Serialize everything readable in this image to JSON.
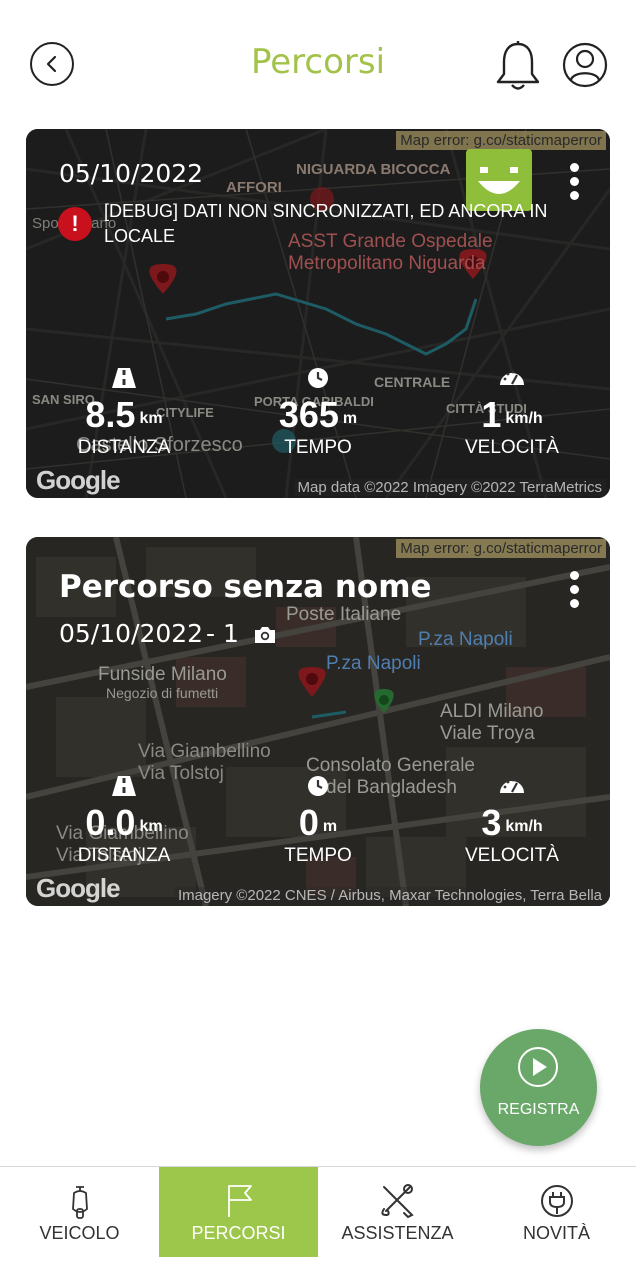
{
  "header": {
    "title": "Percorsi",
    "back_icon": "back-arrow-icon",
    "notification_icon": "bell-icon",
    "profile_icon": "user-icon"
  },
  "colors": {
    "accent": "#a3c24a",
    "active_tab": "#9dc74a",
    "fab": "#6aa86a",
    "error": "#c8111d"
  },
  "routes": [
    {
      "map_error": "Map error: g.co/staticmaperror",
      "date": "05/10/2022",
      "debug_message": "[DEBUG] DATI NON SINCRONIZZATI, ED ANCORA IN LOCALE",
      "stats": {
        "distance": {
          "value": "8.5",
          "unit": "km",
          "label": "DISTANZA"
        },
        "time": {
          "value": "365",
          "unit": "m",
          "label": "TEMPO"
        },
        "speed": {
          "value": "1",
          "unit": "km/h",
          "label": "VELOCITÀ"
        }
      },
      "map_labels": [
        "NIGUARDA BICOCCA",
        "AFFORI",
        "ASST Grande Ospedale",
        "Metropolitano Niguarda",
        "CENTRALE",
        "SAN SIRO",
        "PORTA GARIBALDI",
        "CITTÀ STUDI",
        "Castello Sforzesco",
        "Sport Milano",
        "CITYLIFE"
      ],
      "google": "Google",
      "map_attribution": "Map data ©2022 Imagery ©2022 TerraMetrics"
    },
    {
      "map_error": "Map error: g.co/staticmaperror",
      "name": "Percorso senza nome",
      "date": "05/10/2022",
      "photo_count": "- 1",
      "stats": {
        "distance": {
          "value": "0.0",
          "unit": "km",
          "label": "DISTANZA"
        },
        "time": {
          "value": "0",
          "unit": "m",
          "label": "TEMPO"
        },
        "speed": {
          "value": "3",
          "unit": "km/h",
          "label": "VELOCITÀ"
        }
      },
      "map_labels": [
        "Poste Italiane",
        "P.za Napoli",
        "P.za Napoli",
        "Funside Milano",
        "Negozio di fumetti",
        "ALDI Milano",
        "Viale Troya",
        "Via Giambellino",
        "Via Tolstoj",
        "Consolato Generale",
        "del Bangladesh",
        "Via Giambellino",
        "Via Tolstoj"
      ],
      "google": "Google",
      "map_attribution": "Imagery ©2022 CNES / Airbus, Maxar Technologies, Terra Bella"
    }
  ],
  "fab": {
    "label": "REGISTRA",
    "icon": "play-icon"
  },
  "bottom_nav": [
    {
      "label": "VEICOLO",
      "icon": "scooter-icon",
      "active": false
    },
    {
      "label": "PERCORSI",
      "icon": "flag-icon",
      "active": true
    },
    {
      "label": "ASSISTENZA",
      "icon": "tools-icon",
      "active": false
    },
    {
      "label": "NOVITÀ",
      "icon": "plug-icon",
      "active": false
    }
  ]
}
